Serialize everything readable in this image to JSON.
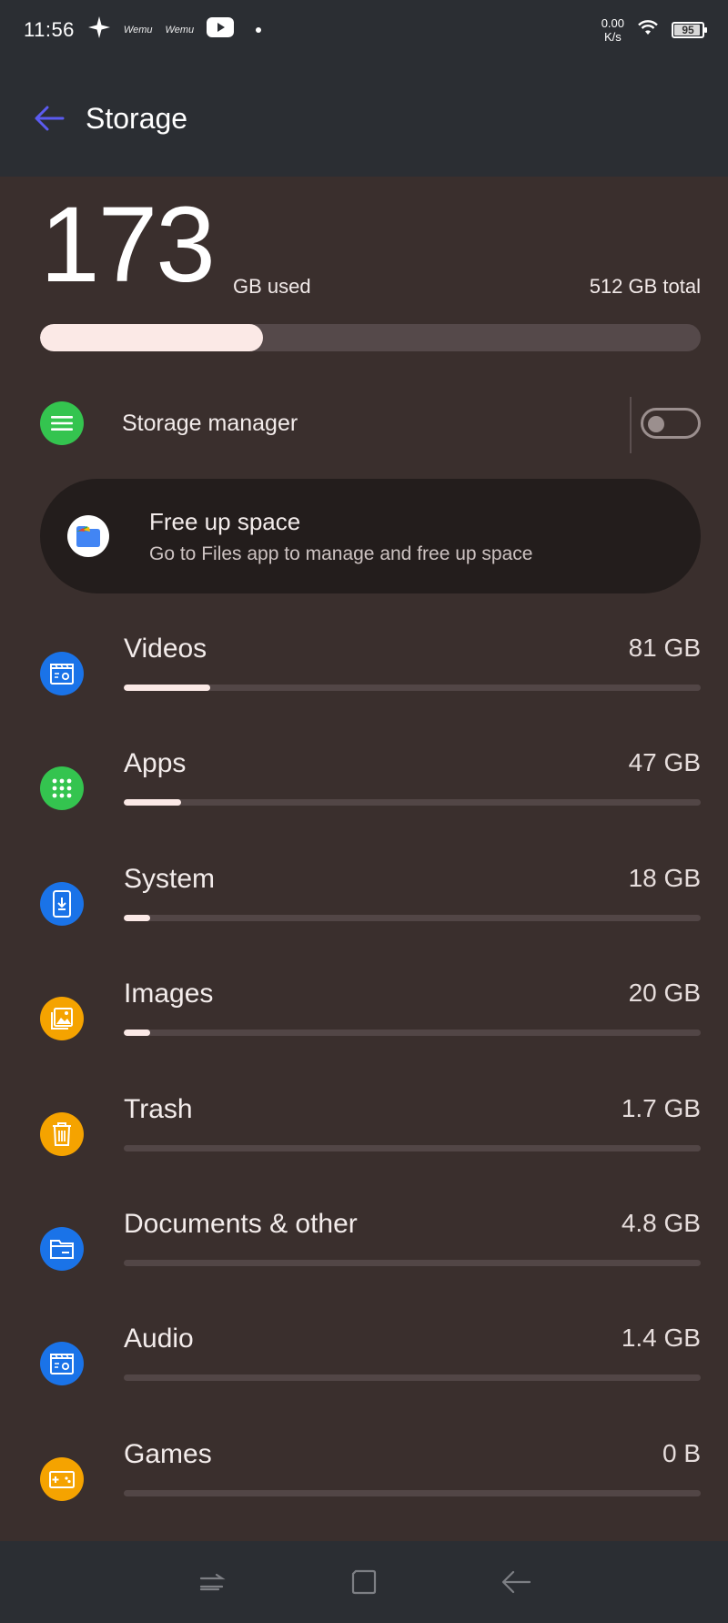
{
  "status_bar": {
    "time": "11:56",
    "notif_labels": [
      "Wemu",
      "Wemu"
    ],
    "net_speed_value": "0.00",
    "net_speed_unit": "K/s",
    "battery": "95",
    "battery_level": 0.95,
    "icons": [
      "sparkle-icon",
      "wemu-icon",
      "wemu-icon",
      "youtube-icon",
      "dot-icon",
      "wifi-icon",
      "battery-icon"
    ]
  },
  "app_bar": {
    "title": "Storage",
    "back_icon": "arrow-left-icon"
  },
  "summary": {
    "used_number": "173",
    "used_label": "GB used",
    "total_label": "512 GB total",
    "used_fraction": 0.338
  },
  "storage_manager": {
    "label": "Storage manager",
    "enabled": false,
    "icon": "list-icon"
  },
  "free_up": {
    "title": "Free up space",
    "subtitle": "Go to Files app to manage and free up space",
    "icon": "files-app-icon"
  },
  "categories": [
    {
      "label": "Videos",
      "size": "81 GB",
      "fraction": 0.15,
      "icon": "clapper-icon",
      "color": "#1a73e8"
    },
    {
      "label": "Apps",
      "size": "47 GB",
      "fraction": 0.1,
      "icon": "apps-grid-icon",
      "color": "#34c44f"
    },
    {
      "label": "System",
      "size": "18 GB",
      "fraction": 0.045,
      "icon": "phone-download-icon",
      "color": "#1a73e8"
    },
    {
      "label": "Images",
      "size": "20 GB",
      "fraction": 0.045,
      "icon": "image-icon",
      "color": "#f5a300"
    },
    {
      "label": "Trash",
      "size": "1.7 GB",
      "fraction": 0,
      "icon": "trash-icon",
      "color": "#f5a300"
    },
    {
      "label": "Documents & other",
      "size": "4.8 GB",
      "fraction": 0,
      "icon": "folder-icon",
      "color": "#1a73e8"
    },
    {
      "label": "Audio",
      "size": "1.4 GB",
      "fraction": 0,
      "icon": "clapper-icon",
      "color": "#1a73e8"
    },
    {
      "label": "Games",
      "size": "0 B",
      "fraction": 0,
      "icon": "gamepad-icon",
      "color": "#f5a300"
    }
  ],
  "nav_bar": {
    "icons": [
      "recents-icon",
      "home-icon",
      "back-icon"
    ]
  },
  "colors": {
    "background": "#3a2f2d",
    "bar_fill": "#fbe9e6",
    "accent_back_arrow": "#5b5bf0",
    "card": "#231d1c"
  }
}
